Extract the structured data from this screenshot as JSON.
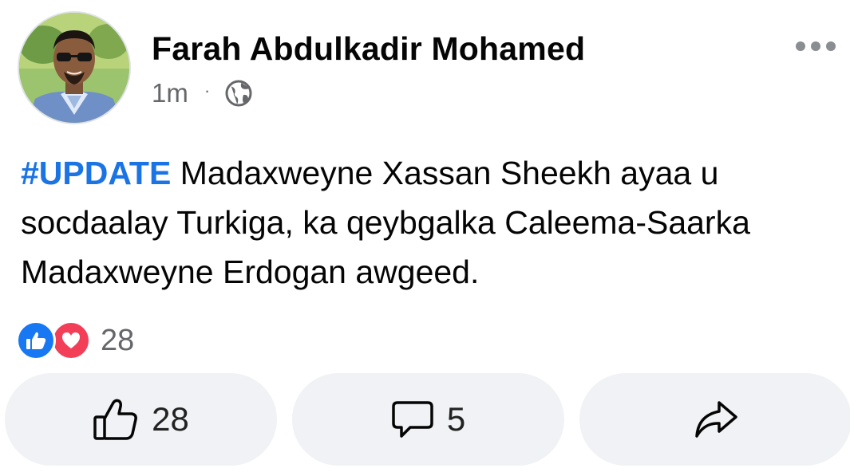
{
  "post": {
    "author": "Farah Abdulkadir Mohamed",
    "time": "1m",
    "separator": "·",
    "privacy_icon": "globe-icon",
    "hashtag": "#UPDATE",
    "text": " Madaxweyne Xassan Sheekh ayaa u socdaalay Turkiga, ka qeybgalka Caleema-Saarka Madaxweyne Erdogan awgeed."
  },
  "reactions": {
    "icons": [
      "like-reaction-icon",
      "love-reaction-icon"
    ],
    "count": "28"
  },
  "actions": {
    "like_count": "28",
    "comment_count": "5"
  },
  "colors": {
    "hashtag": "#1b74e4",
    "like": "#1877f2",
    "love": "#f33e58",
    "button_bg": "#f0f2f5",
    "meta": "#65676b"
  }
}
